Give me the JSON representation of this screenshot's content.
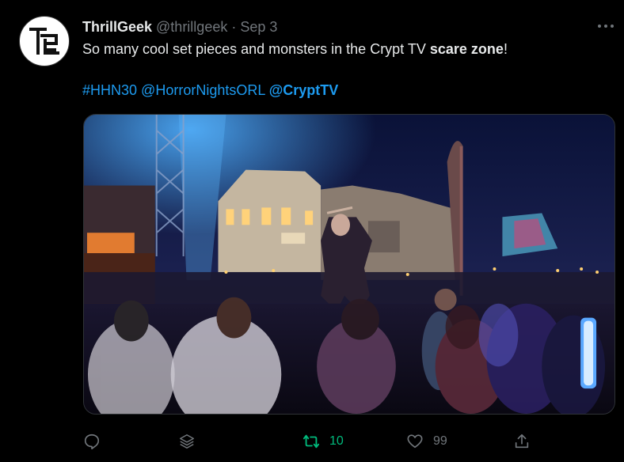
{
  "tweet": {
    "display_name": "ThrillGeek",
    "handle": "@thrillgeek",
    "separator": "·",
    "date": "Sep 3",
    "text_part1": "So many cool set pieces and monsters in the Crypt TV ",
    "text_bold": "scare zone",
    "text_part2": "!",
    "hashtag": "#HHN30",
    "mention1": "@HorrorNightsORL",
    "mention2": "@CryptTV"
  },
  "actions": {
    "reply_icon": "reply-icon",
    "share_stack_icon": "layers-icon",
    "retweet_icon": "retweet-icon",
    "retweet_count": "10",
    "like_icon": "heart-icon",
    "like_count": "99",
    "share_icon": "share-icon"
  },
  "colors": {
    "background": "#000000",
    "text": "#e7e9ea",
    "muted": "#71767b",
    "link": "#1d9bf0",
    "retweet": "#00ba7c"
  }
}
